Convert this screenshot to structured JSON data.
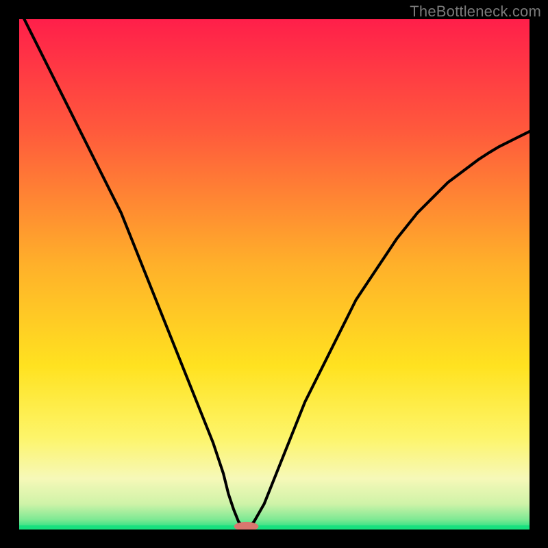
{
  "watermark": "TheBottleneck.com",
  "chart_data": {
    "type": "line",
    "title": "",
    "xlabel": "",
    "ylabel": "",
    "xlim": [
      0,
      100
    ],
    "ylim": [
      0,
      100
    ],
    "grid": false,
    "legend": false,
    "x": [
      0,
      2,
      4,
      6,
      8,
      10,
      12,
      14,
      16,
      18,
      20,
      22,
      24,
      26,
      28,
      30,
      32,
      34,
      36,
      38,
      40,
      41,
      42,
      43,
      44,
      45,
      46,
      48,
      50,
      52,
      54,
      56,
      58,
      60,
      62,
      64,
      66,
      68,
      70,
      72,
      74,
      76,
      78,
      80,
      82,
      84,
      86,
      88,
      90,
      92,
      94,
      96,
      98,
      100
    ],
    "values": [
      102,
      98,
      94,
      90,
      86,
      82,
      78,
      74,
      70,
      66,
      62,
      57,
      52,
      47,
      42,
      37,
      32,
      27,
      22,
      17,
      11,
      7,
      4,
      1.5,
      0.5,
      0.5,
      1.5,
      5,
      10,
      15,
      20,
      25,
      29,
      33,
      37,
      41,
      45,
      48,
      51,
      54,
      57,
      59.5,
      62,
      64,
      66,
      68,
      69.5,
      71,
      72.5,
      73.8,
      75,
      76,
      77,
      78
    ],
    "marker": {
      "x": 44.5,
      "y": 0.6,
      "color": "#d9776f",
      "rx": 2.4,
      "ry": 0.9
    },
    "gradient_stops": [
      {
        "offset": 0,
        "color": "#ff1f4a"
      },
      {
        "offset": 22,
        "color": "#ff5a3c"
      },
      {
        "offset": 48,
        "color": "#ffb02a"
      },
      {
        "offset": 68,
        "color": "#ffe220"
      },
      {
        "offset": 82,
        "color": "#fdf56a"
      },
      {
        "offset": 90,
        "color": "#f6f8b8"
      },
      {
        "offset": 95,
        "color": "#cff3a8"
      },
      {
        "offset": 98,
        "color": "#7fe994"
      },
      {
        "offset": 100,
        "color": "#18e07f"
      }
    ],
    "green_band_top": 96
  }
}
